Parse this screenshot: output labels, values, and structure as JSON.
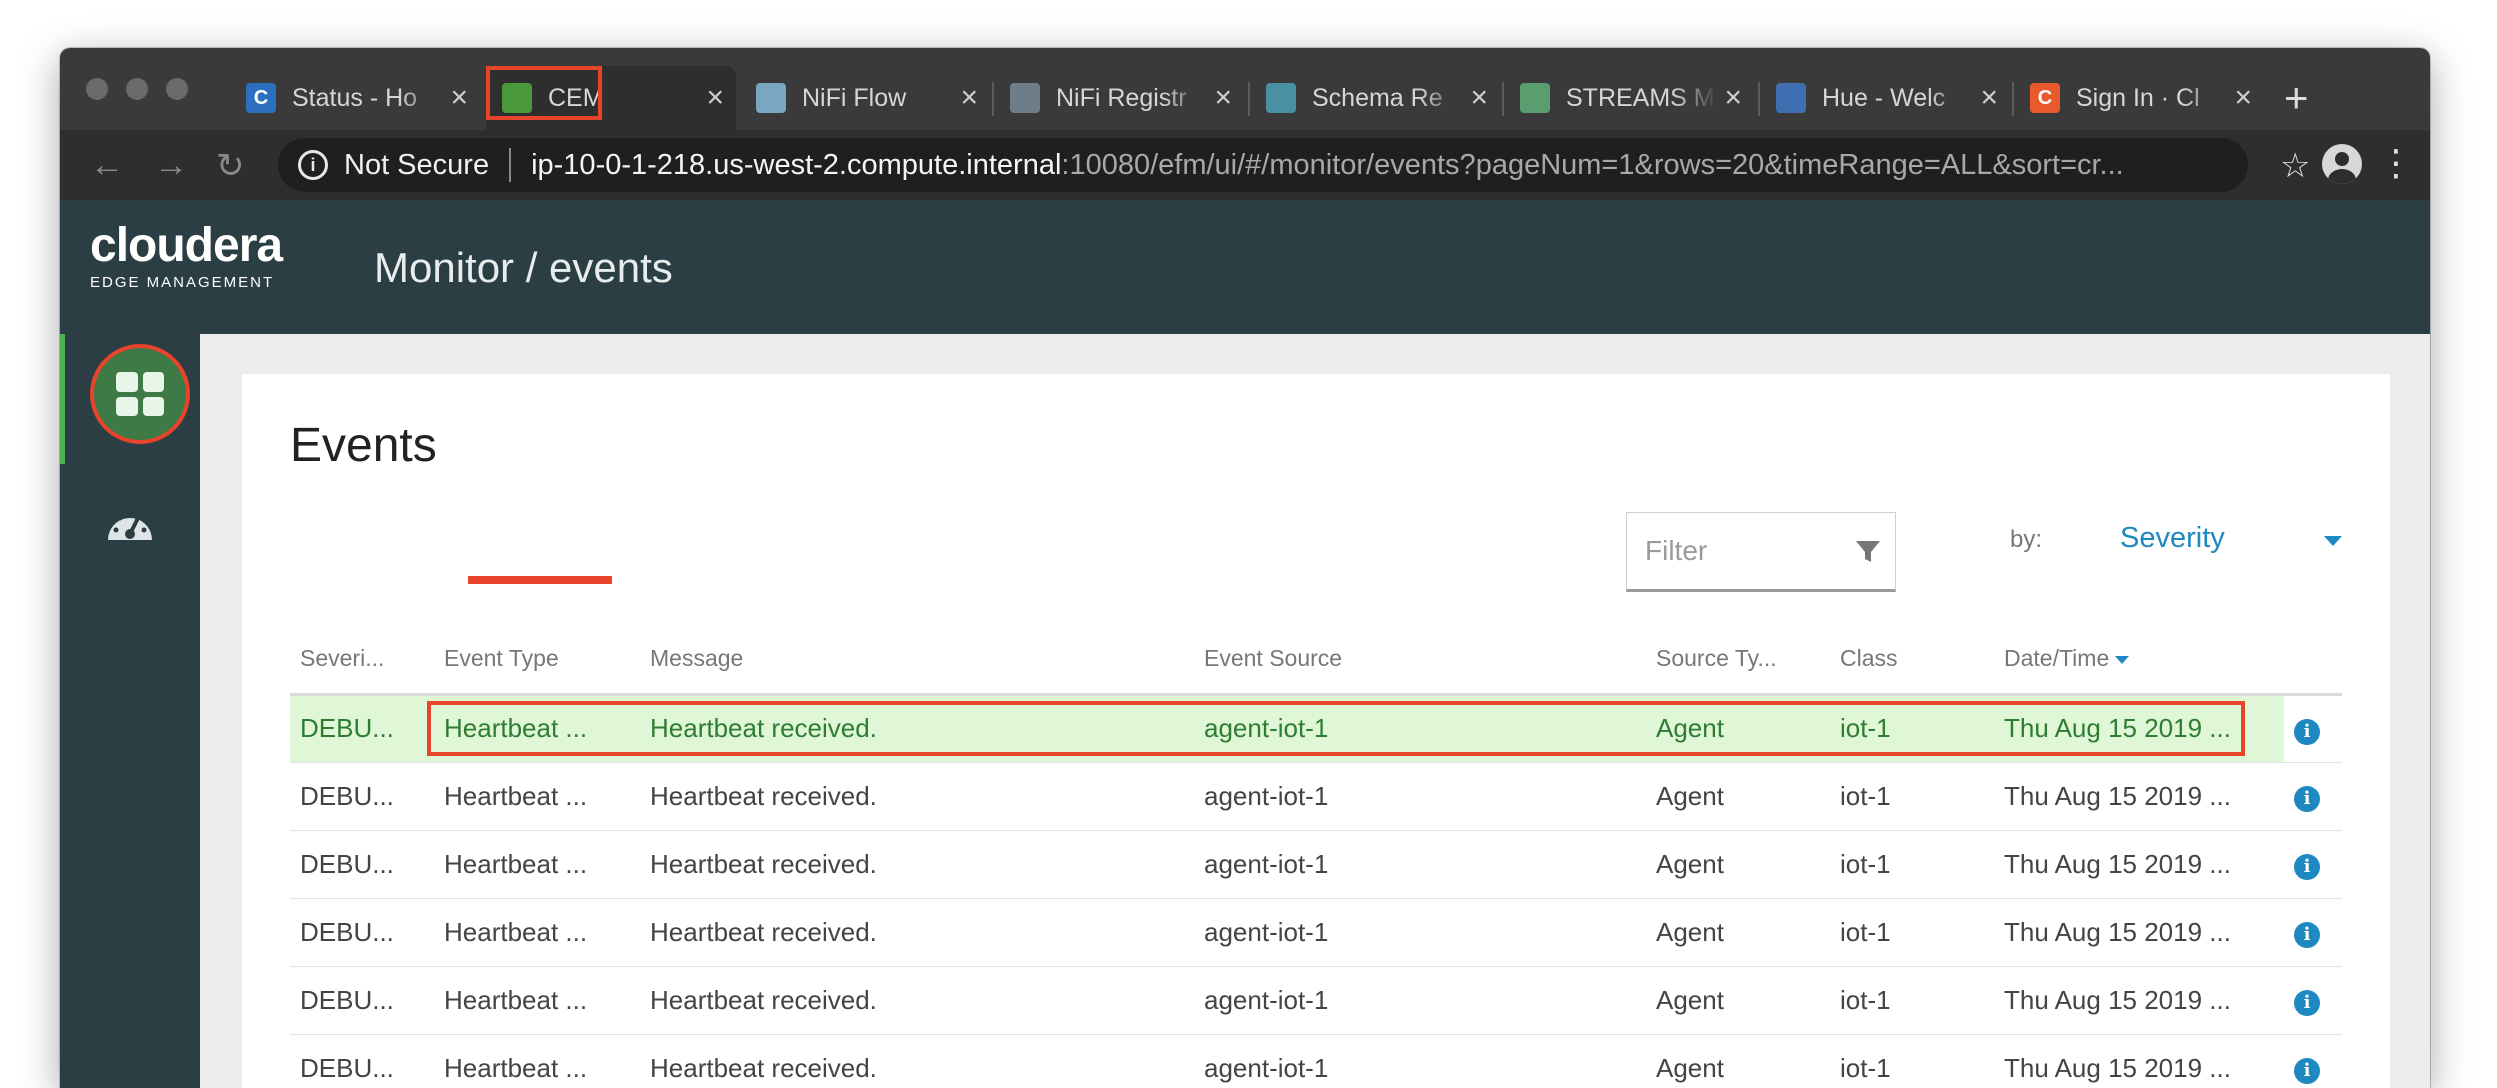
{
  "browser": {
    "tabs": [
      {
        "label": "Status - Ho",
        "favicon": "C",
        "favicon_color": "#2c6fbf"
      },
      {
        "label": "CEM",
        "favicon": "",
        "favicon_color": "#4a9a3c"
      },
      {
        "label": "NiFi Flow",
        "favicon": "",
        "favicon_color": "#7aa6c2"
      },
      {
        "label": "NiFi Registr",
        "favicon": "",
        "favicon_color": "#6f7d8a"
      },
      {
        "label": "Schema Re",
        "favicon": "",
        "favicon_color": "#4a90a4"
      },
      {
        "label": "STREAMS M",
        "favicon": "",
        "favicon_color": "#5a9e6f"
      },
      {
        "label": "Hue - Welc",
        "favicon": "",
        "favicon_color": "#3f6fb0"
      },
      {
        "label": "Sign In · Cl",
        "favicon": "C",
        "favicon_color": "#e8592b"
      }
    ],
    "address": {
      "security": "Not Secure",
      "host": "ip-10-0-1-218.us-west-2.compute.internal",
      "path": ":10080/efm/ui/#/monitor/events?pageNum=1&rows=20&timeRange=ALL&sort=cr..."
    }
  },
  "app": {
    "logo_word": "cloudera",
    "logo_sub": "EDGE MANAGEMENT",
    "title": "Monitor / events"
  },
  "page": {
    "heading": "Events",
    "filter_placeholder": "Filter",
    "by_label": "by:",
    "by_value": "Severity"
  },
  "table": {
    "columns": [
      "Severi...",
      "Event Type",
      "Message",
      "Event Source",
      "Source Ty...",
      "Class",
      "Date/Time"
    ],
    "rows": [
      [
        "DEBU...",
        "Heartbeat ...",
        "Heartbeat received.",
        "agent-iot-1",
        "Agent",
        "iot-1",
        "Thu Aug 15 2019 ..."
      ],
      [
        "DEBU...",
        "Heartbeat ...",
        "Heartbeat received.",
        "agent-iot-1",
        "Agent",
        "iot-1",
        "Thu Aug 15 2019 ..."
      ],
      [
        "DEBU...",
        "Heartbeat ...",
        "Heartbeat received.",
        "agent-iot-1",
        "Agent",
        "iot-1",
        "Thu Aug 15 2019 ..."
      ],
      [
        "DEBU...",
        "Heartbeat ...",
        "Heartbeat received.",
        "agent-iot-1",
        "Agent",
        "iot-1",
        "Thu Aug 15 2019 ..."
      ],
      [
        "DEBU...",
        "Heartbeat ...",
        "Heartbeat received.",
        "agent-iot-1",
        "Agent",
        "iot-1",
        "Thu Aug 15 2019 ..."
      ],
      [
        "DEBU...",
        "Heartbeat ...",
        "Heartbeat received.",
        "agent-iot-1",
        "Agent",
        "iot-1",
        "Thu Aug 15 2019 ..."
      ]
    ]
  },
  "colors": {
    "header_bg": "#2b3e43",
    "accent_blue": "#1e88c0",
    "highlight_row": "#dff7d6",
    "annotation_red": "#e8432b"
  }
}
